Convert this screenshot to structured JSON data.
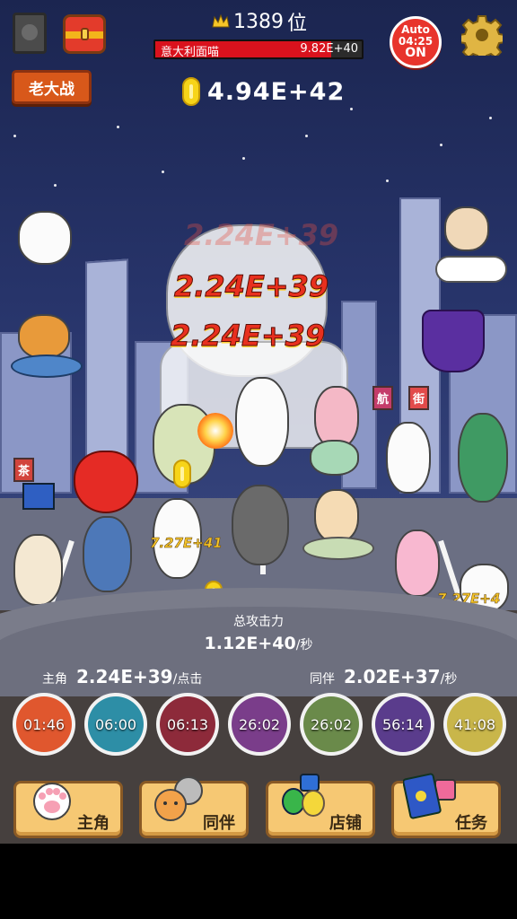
{
  "hud": {
    "rank": "1389",
    "rank_suffix": "位",
    "boss_name": "意大利面喵",
    "boss_hp": "9.82E+40",
    "boss_hp_fraction": 0.85,
    "auto_label": "Auto",
    "auto_time": "04:25",
    "auto_state": "ON",
    "boss_battle_label": "老大战",
    "gold": "4.94E+42"
  },
  "damage": {
    "big_1": "2.24E+39",
    "big_2": "2.24E+39",
    "ghost": "2.24E+39",
    "small_1": "7.27E+41",
    "small_2": "7.27E+4"
  },
  "stats": {
    "total_label": "总攻击力",
    "total_value": "1.12E+40",
    "per_second": "/秒",
    "hero_label": "主角",
    "hero_value": "2.24E+39",
    "per_click": "/点击",
    "partner_label": "同伴",
    "partner_value": "2.02E+37"
  },
  "skills": [
    {
      "time": "01:46",
      "color": "#e0572e"
    },
    {
      "time": "06:00",
      "color": "#2d8ea6"
    },
    {
      "time": "06:13",
      "color": "#8d2a3a"
    },
    {
      "time": "26:02",
      "color": "#7a3d8a"
    },
    {
      "time": "26:02",
      "color": "#6a8a4a"
    },
    {
      "time": "56:14",
      "color": "#5a3c8c"
    },
    {
      "time": "41:08",
      "color": "#c9b64a"
    }
  ],
  "tabs": [
    {
      "label": "主角",
      "icon": "paw-icon"
    },
    {
      "label": "同伴",
      "icon": "cats-icon"
    },
    {
      "label": "店铺",
      "icon": "gems-icon"
    },
    {
      "label": "任务",
      "icon": "book-icon"
    }
  ],
  "colors": {
    "accent_red": "#e8342c",
    "tab_bg": "#f6c873",
    "coin": "#f7d419"
  }
}
